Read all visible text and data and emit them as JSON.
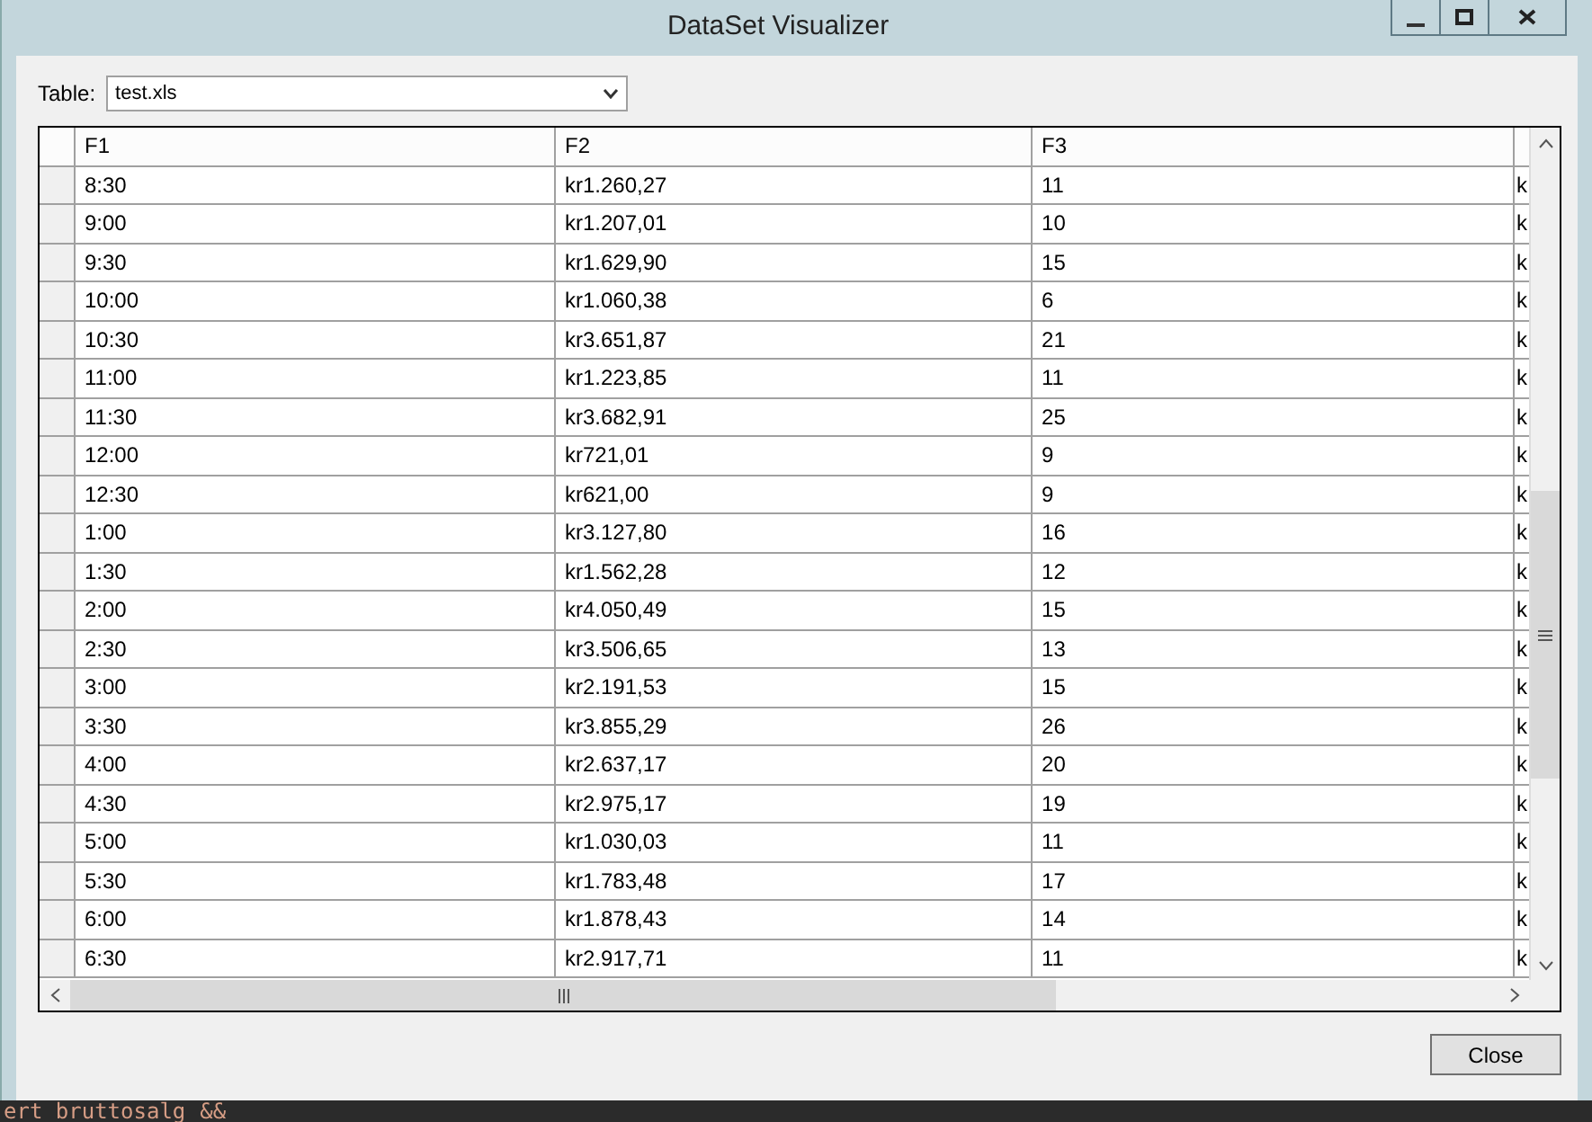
{
  "window": {
    "title": "DataSet Visualizer"
  },
  "table_selector": {
    "label": "Table:",
    "value": "test.xls"
  },
  "grid": {
    "columns": [
      "F1",
      "F2",
      "F3"
    ],
    "rows": [
      {
        "f1": "8:30",
        "f2": "kr1.260,27",
        "f3": "11",
        "column_4": "k"
      },
      {
        "f1": "9:00",
        "f2": "kr1.207,01",
        "f3": "10",
        "column_4": "k"
      },
      {
        "f1": "9:30",
        "f2": "kr1.629,90",
        "f3": "15",
        "column_4": "k"
      },
      {
        "f1": "10:00",
        "f2": "kr1.060,38",
        "f3": "6",
        "column_4": "k"
      },
      {
        "f1": "10:30",
        "f2": "kr3.651,87",
        "f3": "21",
        "column_4": "k"
      },
      {
        "f1": "11:00",
        "f2": "kr1.223,85",
        "f3": "11",
        "column_4": "k"
      },
      {
        "f1": "11:30",
        "f2": "kr3.682,91",
        "f3": "25",
        "column_4": "k"
      },
      {
        "f1": "12:00",
        "f2": "kr721,01",
        "f3": "9",
        "column_4": "k"
      },
      {
        "f1": "12:30",
        "f2": "kr621,00",
        "f3": "9",
        "column_4": "k"
      },
      {
        "f1": "1:00",
        "f2": "kr3.127,80",
        "f3": "16",
        "column_4": "k"
      },
      {
        "f1": "1:30",
        "f2": "kr1.562,28",
        "f3": "12",
        "column_4": "k"
      },
      {
        "f1": "2:00",
        "f2": "kr4.050,49",
        "f3": "15",
        "column_4": "k"
      },
      {
        "f1": "2:30",
        "f2": "kr3.506,65",
        "f3": "13",
        "column_4": "k"
      },
      {
        "f1": "3:00",
        "f2": "kr2.191,53",
        "f3": "15",
        "column_4": "k"
      },
      {
        "f1": "3:30",
        "f2": "kr3.855,29",
        "f3": "26",
        "column_4": "k"
      },
      {
        "f1": "4:00",
        "f2": "kr2.637,17",
        "f3": "20",
        "column_4": "k"
      },
      {
        "f1": "4:30",
        "f2": "kr2.975,17",
        "f3": "19",
        "column_4": "k"
      },
      {
        "f1": "5:00",
        "f2": "kr1.030,03",
        "f3": "11",
        "column_4": "k"
      },
      {
        "f1": "5:30",
        "f2": "kr1.783,48",
        "f3": "17",
        "column_4": "k"
      },
      {
        "f1": "6:00",
        "f2": "kr1.878,43",
        "f3": "14",
        "column_4": "k"
      },
      {
        "f1": "6:30",
        "f2": "kr2.917,71",
        "f3": "11",
        "column_4": "k"
      }
    ]
  },
  "buttons": [
    "Close"
  ],
  "background_editor": {
    "text": "ert bruttosalg",
    "operator": "&&"
  }
}
